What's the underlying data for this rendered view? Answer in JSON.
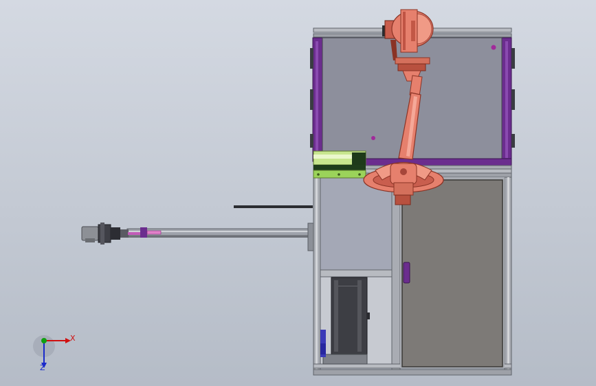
{
  "app": {
    "title": "",
    "view": "front"
  },
  "triad": {
    "x_label": "X",
    "z_label": "Z",
    "colors": {
      "x": "#d01010",
      "y": "#10a010",
      "z": "#1a2acb"
    }
  },
  "colors": {
    "background": "#c8ced8",
    "frame": "#a9acb3",
    "frame_dark": "#6e7178",
    "panel_purple": "#6b2d8e",
    "glass": "#8d8f9c",
    "door": "#7d7a77",
    "robot": "#e6806d",
    "robot_dark": "#b44c3d",
    "green_device": "#9bd35a"
  },
  "model": {
    "components": [
      "cell-frame",
      "robot-arm",
      "linear-conveyor",
      "gripper-end-effector",
      "green-controller-box",
      "electrical-cabinet-door",
      "base-cabinet"
    ]
  }
}
